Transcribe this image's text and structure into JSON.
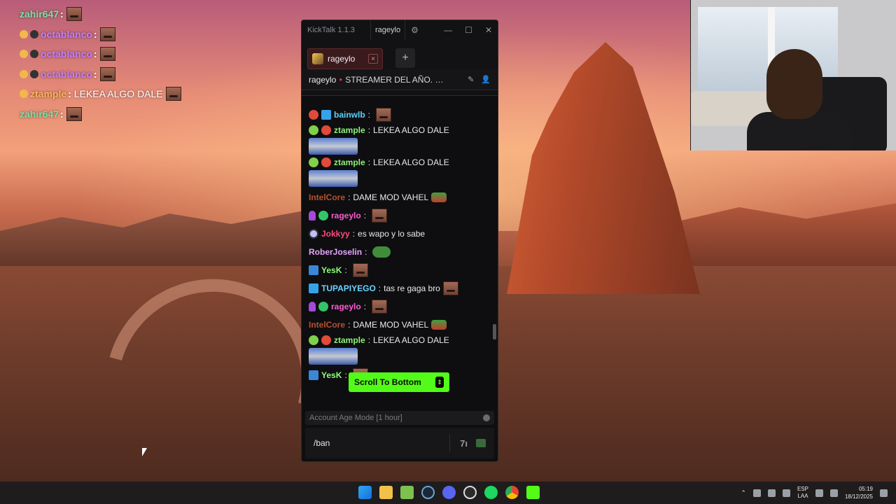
{
  "overlay": {
    "lines": [
      {
        "user": "zahir647",
        "sep": ":",
        "msg": "",
        "badges": 0
      },
      {
        "user": "octablanco",
        "sep": ":",
        "msg": "",
        "badges": 2
      },
      {
        "user": "octablanco",
        "sep": ":",
        "msg": "",
        "badges": 2
      },
      {
        "user": "octablanco",
        "sep": ":",
        "msg": "",
        "badges": 2
      },
      {
        "user": "ztample",
        "sep": ":",
        "msg": "LEKEA ALGO DALE",
        "badges": 1
      },
      {
        "user": "zahir647",
        "sep": ":",
        "msg": "",
        "badges": 0
      }
    ],
    "colors": {
      "zahir647": "#7fe0a6",
      "octablanco": "#c77dff",
      "ztample": "#ffb45a"
    }
  },
  "kicktalk": {
    "app_title": "KickTalk 1.1.3",
    "title_user": "rageylo",
    "tab": {
      "label": "rageylo",
      "close": "×"
    },
    "add_tab": "+",
    "stream_header": {
      "channel": "rageylo",
      "title": "STREAMER DEL AÑO. G..."
    },
    "messages": [
      {
        "user": "bainwlb",
        "sep": ":",
        "text": "",
        "color": "#5bd1ff"
      },
      {
        "user": "ztample",
        "sep": ":",
        "text": "LEKEA ALGO DALE",
        "color": "#8cf07a"
      },
      {
        "user": "ztample",
        "sep": ":",
        "text": "LEKEA ALGO DALE",
        "color": "#8cf07a"
      },
      {
        "user": "IntelCore",
        "sep": ":",
        "text": "DAME MOD VAHEL",
        "color": "#b8502e"
      },
      {
        "user": "rageylo",
        "sep": ":",
        "text": "",
        "color": "#ff5ad2"
      },
      {
        "user": "Jokkyy",
        "sep": ":",
        "text": "es wapo y lo sabe",
        "color": "#ff4a7a"
      },
      {
        "user": "RoberJoselin",
        "sep": ":",
        "text": "",
        "color": "#e7a4ff"
      },
      {
        "user": "YesK",
        "sep": ":",
        "text": "",
        "color": "#8dff7a"
      },
      {
        "user": "TUPAPIYEGO",
        "sep": ":",
        "text": "tas re gaga bro",
        "color": "#6ad2ff"
      },
      {
        "user": "rageylo",
        "sep": ":",
        "text": "",
        "color": "#ff5ad2"
      },
      {
        "user": "IntelCore",
        "sep": ":",
        "text": "DAME MOD VAHEL",
        "color": "#b8502e"
      },
      {
        "user": "ztample",
        "sep": ":",
        "text": "LEKEA ALGO DALE",
        "color": "#8cf07a"
      },
      {
        "user": "YesK",
        "sep": ":",
        "text": "",
        "color": "#8dff7a"
      }
    ],
    "scroll_to_bottom": "Scroll To Bottom",
    "mode_label": "Account Age Mode [1 hour]",
    "input_value": "/ban",
    "emote_btn": "7ı"
  },
  "taskbar": {
    "lang_top": "ESP",
    "lang_bottom": "LAA",
    "time": "05:19",
    "date": "18/12/2025"
  }
}
